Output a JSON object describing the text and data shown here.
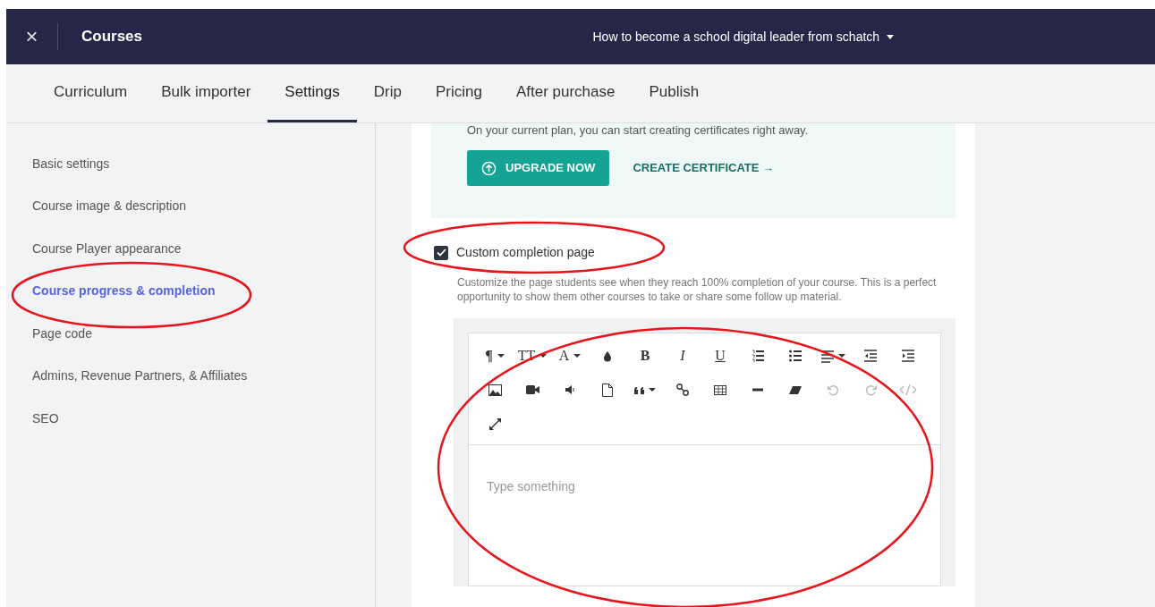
{
  "header": {
    "close": "×",
    "section": "Courses",
    "course_title": "How to become a school digital leader from schatch"
  },
  "tabs": [
    {
      "label": "Curriculum",
      "selected": false
    },
    {
      "label": "Bulk importer",
      "selected": false
    },
    {
      "label": "Settings",
      "selected": true
    },
    {
      "label": "Drip",
      "selected": false
    },
    {
      "label": "Pricing",
      "selected": false
    },
    {
      "label": "After purchase",
      "selected": false
    },
    {
      "label": "Publish",
      "selected": false
    }
  ],
  "sidebar": {
    "items": [
      {
        "label": "Basic settings",
        "selected": false
      },
      {
        "label": "Course image & description",
        "selected": false
      },
      {
        "label": "Course Player appearance",
        "selected": false
      },
      {
        "label": "Course progress & completion",
        "selected": true
      },
      {
        "label": "Page code",
        "selected": false
      },
      {
        "label": "Admins, Revenue Partners, & Affiliates",
        "selected": false
      },
      {
        "label": "SEO",
        "selected": false
      }
    ]
  },
  "certificate_notice": {
    "text": "On your current plan, you can start creating certificates right away.",
    "upgrade_button": "UPGRADE NOW",
    "create_link": "CREATE CERTIFICATE →"
  },
  "completion": {
    "label": "Custom completion page",
    "checked": true,
    "help": "Customize the page students see when they reach 100% completion of your course. This is a perfect opportunity to show them other courses to take or share some follow up material."
  },
  "editor": {
    "placeholder": "Type something",
    "toolbar": [
      [
        {
          "kind": "paragraph",
          "label": "¶",
          "dropdown": true,
          "disabled": false
        },
        {
          "kind": "font-size",
          "label": "TT",
          "dropdown": true,
          "disabled": false
        },
        {
          "kind": "font-color",
          "label": "A",
          "dropdown": true,
          "disabled": false
        },
        {
          "kind": "drop",
          "dropdown": false,
          "disabled": false
        },
        {
          "kind": "bold",
          "label": "B",
          "dropdown": false,
          "disabled": false
        },
        {
          "kind": "italic",
          "label": "I",
          "dropdown": false,
          "disabled": false
        },
        {
          "kind": "underline",
          "label": "U",
          "dropdown": false,
          "disabled": false
        },
        {
          "kind": "ordered-list",
          "dropdown": false,
          "disabled": false
        },
        {
          "kind": "bullet-list",
          "dropdown": false,
          "disabled": false
        },
        {
          "kind": "align",
          "dropdown": true,
          "disabled": false
        },
        {
          "kind": "outdent",
          "dropdown": false,
          "disabled": false
        },
        {
          "kind": "indent",
          "dropdown": false,
          "disabled": false
        }
      ],
      [
        {
          "kind": "image",
          "dropdown": false,
          "disabled": false
        },
        {
          "kind": "video",
          "dropdown": false,
          "disabled": false
        },
        {
          "kind": "audio",
          "dropdown": false,
          "disabled": false
        },
        {
          "kind": "file",
          "dropdown": false,
          "disabled": false
        },
        {
          "kind": "quote",
          "dropdown": true,
          "disabled": false
        },
        {
          "kind": "link",
          "dropdown": false,
          "disabled": false
        },
        {
          "kind": "table",
          "dropdown": false,
          "disabled": false
        },
        {
          "kind": "rule",
          "dropdown": false,
          "disabled": false
        },
        {
          "kind": "eraser",
          "dropdown": false,
          "disabled": false
        },
        {
          "kind": "undo",
          "dropdown": false,
          "disabled": true
        },
        {
          "kind": "redo",
          "dropdown": false,
          "disabled": true
        },
        {
          "kind": "code",
          "dropdown": false,
          "disabled": true
        }
      ],
      [
        {
          "kind": "fullscreen",
          "dropdown": false,
          "disabled": false
        }
      ]
    ]
  }
}
